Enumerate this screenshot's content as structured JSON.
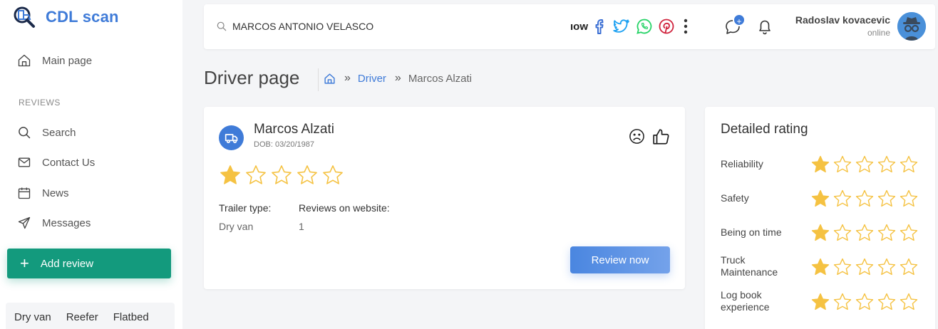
{
  "app": {
    "name": "CDL scan",
    "brand_color": "#3f7bd8"
  },
  "sidebar": {
    "main_page": "Main page",
    "section_label": "REVIEWS",
    "items": [
      {
        "label": "Search",
        "icon": "search-icon"
      },
      {
        "label": "Contact Us",
        "icon": "mail-icon"
      },
      {
        "label": "News",
        "icon": "calendar-icon"
      },
      {
        "label": "Messages",
        "icon": "send-icon"
      }
    ],
    "add_review": "Add review",
    "add_review_color": "#139a7d",
    "filters": [
      "Dry van",
      "Reefer",
      "Flatbed"
    ]
  },
  "topbar": {
    "search_value": "MARCOS ANTONIO VELASCO",
    "share_text": "ıow",
    "social": [
      "facebook-icon",
      "twitter-icon",
      "whatsapp-icon",
      "pinterest-icon"
    ],
    "chat_badge": "+",
    "user_name": "Radoslav kovacevic",
    "user_status": "online"
  },
  "page": {
    "title": "Driver page",
    "breadcrumb": [
      "Driver",
      "Marcos Alzati"
    ]
  },
  "driver": {
    "name": "Marcos Alzati",
    "dob": "DOB: 03/20/1987",
    "rating": 1,
    "rating_max": 5,
    "trailer_label": "Trailer type:",
    "trailer_value": "Dry van",
    "reviews_label": "Reviews on website:",
    "reviews_value": "1",
    "review_button": "Review now"
  },
  "detailed_rating": {
    "title": "Detailed rating",
    "items": [
      {
        "label": "Reliability",
        "value": 1
      },
      {
        "label": "Safety",
        "value": 1
      },
      {
        "label": "Being on time",
        "value": 1
      },
      {
        "label": "Truck Maintenance",
        "value": 1
      },
      {
        "label": "Log book experience",
        "value": 1
      }
    ],
    "max": 5,
    "star_color": "#f5c242"
  }
}
